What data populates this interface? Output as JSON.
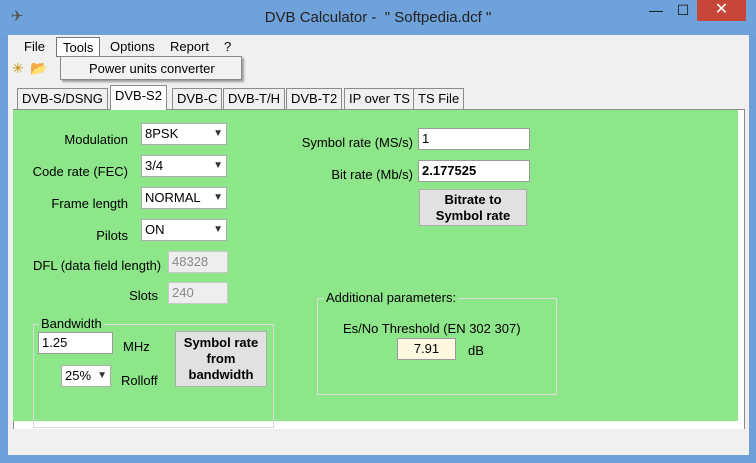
{
  "window": {
    "title": "DVB Calculator -  \" Softpedia.dcf \"",
    "close_glyph": "✕",
    "min_glyph": "—",
    "max_glyph": "☐"
  },
  "menu": {
    "items": [
      "File",
      "Tools",
      "Options",
      "Report",
      "?"
    ],
    "open_menu_items": [
      "Power units converter"
    ]
  },
  "tabs": [
    "DVB-S/DSNG",
    "DVB-S2",
    "DVB-C",
    "DVB-T/H",
    "DVB-T2",
    "IP over TS",
    "TS File"
  ],
  "active_tab": "DVB-S2",
  "form": {
    "modulation": {
      "label": "Modulation",
      "value": "8PSK"
    },
    "code_rate": {
      "label": "Code rate (FEC)",
      "value": "3/4"
    },
    "frame_length": {
      "label": "Frame length",
      "value": "NORMAL"
    },
    "pilots": {
      "label": "Pilots",
      "value": "ON"
    },
    "dfl": {
      "label": "DFL (data field length)",
      "value": "48328"
    },
    "slots": {
      "label": "Slots",
      "value": "240"
    },
    "symbol_rate": {
      "label": "Symbol rate (MS/s)",
      "value": "1"
    },
    "bit_rate": {
      "label": "Bit rate (Mb/s)",
      "value": "2.177525"
    },
    "bitrate_to_symbol_button": [
      "Bitrate to",
      "Symbol rate"
    ]
  },
  "bandwidth": {
    "title": "Bandwidth",
    "value": "1.25",
    "unit": "MHz",
    "rolloff_value": "25%",
    "rolloff_label": "Rolloff",
    "button": [
      "Symbol rate",
      "from",
      "bandwidth"
    ]
  },
  "additional": {
    "title": "Additional parameters:",
    "threshold_label": "Es/No Threshold (EN 302 307)",
    "threshold_value": "7.91",
    "threshold_unit": "dB"
  },
  "colors": {
    "panel": "#8ee68a",
    "titlebar": "#6fa1da",
    "close": "#c7463a"
  }
}
